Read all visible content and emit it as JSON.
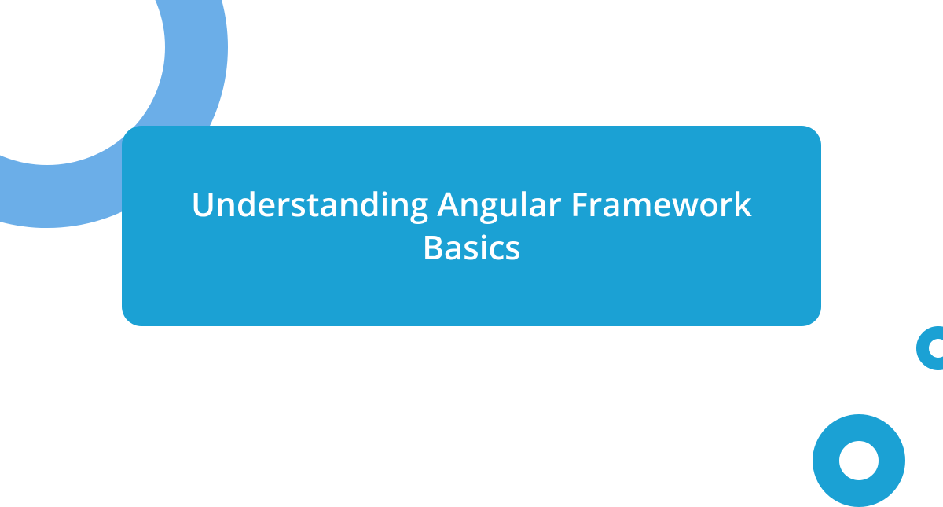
{
  "title": "Understanding Angular Framework Basics",
  "colors": {
    "panel": "#1ba1d4",
    "accent_light": "#6baee8",
    "text": "#ffffff"
  }
}
